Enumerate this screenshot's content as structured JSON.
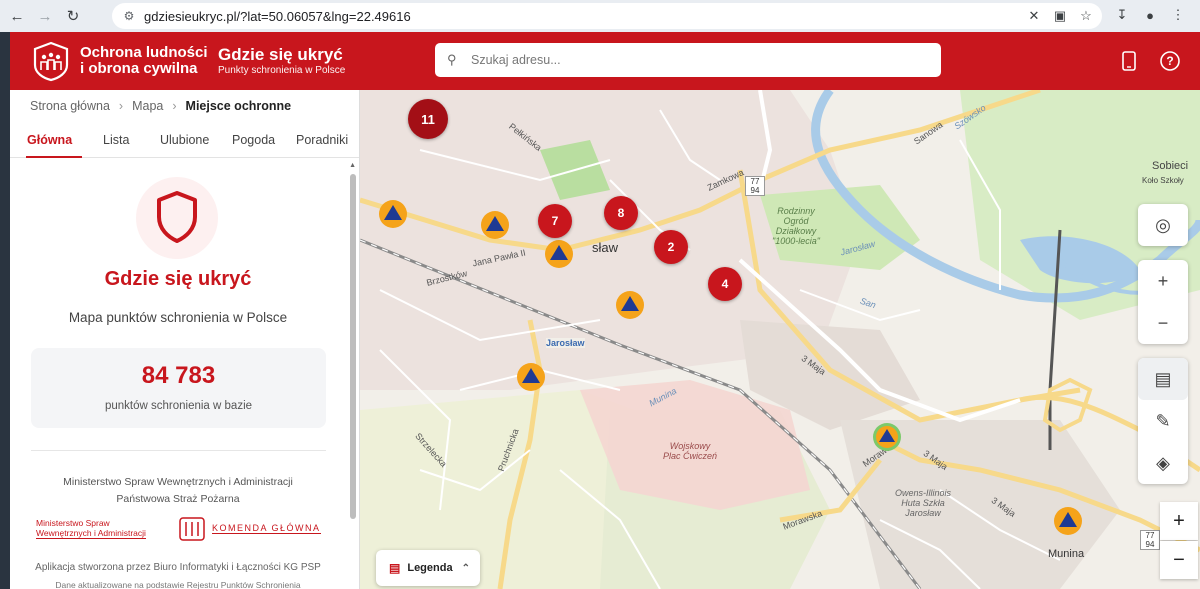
{
  "browser": {
    "url": "gdziesieukryc.pl/?lat=50.06057&lng=22.49616",
    "back_icon": "arrow-left-icon",
    "forward_icon": "arrow-right-icon",
    "reload_icon": "reload-icon"
  },
  "header": {
    "org_line1": "Ochrona ludności",
    "org_line2": "i obrona cywilna",
    "app_title": "Gdzie się ukryć",
    "app_subtitle": "Punkty schronienia w Polsce",
    "search_placeholder": "Szukaj adresu..."
  },
  "breadcrumb": {
    "home": "Strona główna",
    "map": "Mapa",
    "current": "Miejsce ochronne"
  },
  "tabs": [
    {
      "label": "Główna",
      "active": true
    },
    {
      "label": "Lista",
      "active": false
    },
    {
      "label": "Ulubione",
      "active": false
    },
    {
      "label": "Pogoda",
      "active": false
    },
    {
      "label": "Poradniki",
      "active": false
    }
  ],
  "main": {
    "title": "Gdzie się ukryć",
    "subtitle": "Mapa punktów schronienia w Polsce",
    "stat_value": "84 783",
    "stat_label": "punktów schronienia w bazie"
  },
  "footer": {
    "ministry_line1": "Ministerstwo Spraw Wewnętrznych i Administracji",
    "ministry_line2": "Państwowa Straż Pożarna",
    "logo_mswia_line1": "Ministerstwo Spraw",
    "logo_mswia_line2": "Wewnętrznych i Administracji",
    "logo_kg": "KOMENDA GŁÓWNA",
    "credit": "Aplikacja stworzona przez Biuro Informatyki i Łączności KG PSP",
    "data_note": "Dane aktualizowane na podstawie Rejestru Punktów Schronienia"
  },
  "map": {
    "clusters": [
      "11",
      "7",
      "8",
      "2",
      "4"
    ],
    "labels": {
      "city": "sław",
      "station": "Jarosław",
      "street_pelkinska": "Pełkińska",
      "street_zamkowa": "Zamkowa",
      "street_jana_pawla": "Jana Pawła II",
      "street_brzostkow": "Brzostków",
      "street_3maja_a": "3 Maja",
      "street_3maja_b": "3 Maja",
      "street_3maja_c": "3 Maja",
      "street_morawska_a": "Morawska",
      "street_morawska_b": "Morawska",
      "street_strzelecka": "Strzelecka",
      "street_pruchnicka": "Pruchnicka",
      "street_sanowa": "Sanowa",
      "street_szowsko": "Szówsko",
      "street_munina": "Munina",
      "street_jaroslaw_road": "Jarosław",
      "allotments": "Rodzinny Ogród Działkowy \"1000-lecia\"",
      "training_field": "Wojskowy Plac Ćwiczeń",
      "owens": "Owens-Illinois Huta Szkła Jarosław",
      "village_munina": "Munina",
      "village_sobiecin": "Sobieci",
      "village_kolo": "Koło Szkoły",
      "river_san": "San",
      "route_7794a": "77 94",
      "route_7794b": "77 94"
    },
    "legend_label": "Legenda"
  },
  "colors": {
    "brand_red": "#c8161d",
    "pin_orange": "#f5a31a",
    "pin_blue": "#1f3a93"
  }
}
